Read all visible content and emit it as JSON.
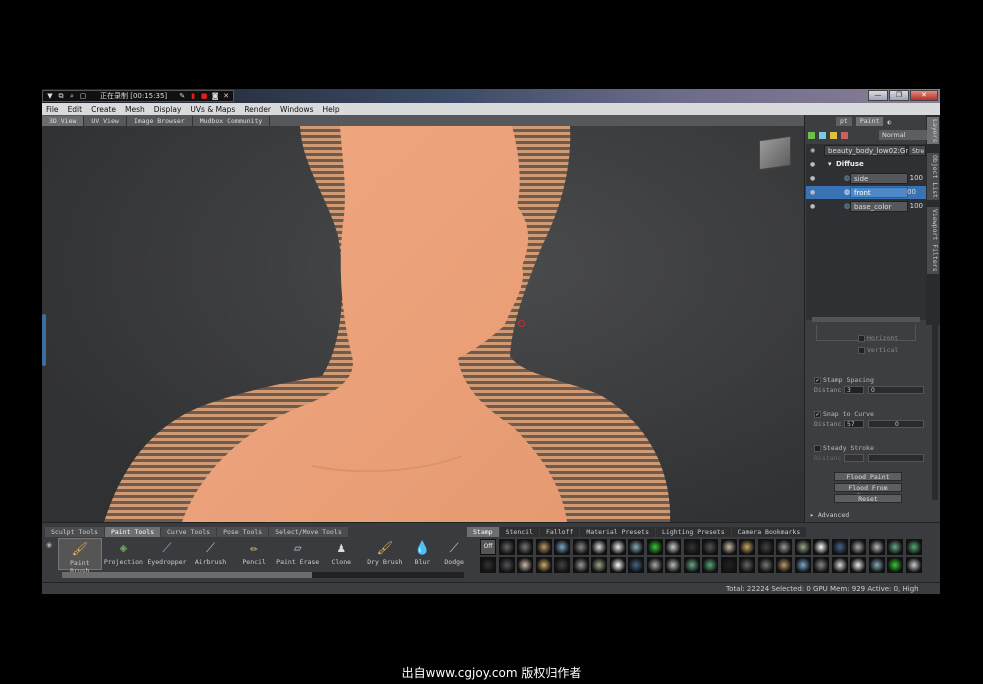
{
  "recorder": {
    "status": "正在录制 [00:15:35]"
  },
  "menu": [
    "File",
    "Edit",
    "Create",
    "Mesh",
    "Display",
    "UVs & Maps",
    "Render",
    "Windows",
    "Help"
  ],
  "view_tabs": [
    "3D View",
    "UV View",
    "Image Browser",
    "Mudbox Community"
  ],
  "right_panel": {
    "header_tabs": [
      "pt",
      "Paint"
    ],
    "blend_mode": "Normal",
    "side_tabs": [
      "Layers",
      "Object List",
      "Viewport Filters"
    ],
    "layers": {
      "object": "beauty_body_low02:Gr",
      "object_suffix": "Stre",
      "group": "Diffuse",
      "items": [
        {
          "name": "side",
          "opacity": "100"
        },
        {
          "name": "front",
          "opacity": "00",
          "selected": true
        },
        {
          "name": "base_color",
          "opacity": "100"
        }
      ]
    },
    "props": {
      "horizontal": "Horizont",
      "vertical": "Vertical",
      "stamp_spacing": "Stamp Spacing",
      "stamp_distance_label": "Distanc",
      "stamp_distance_value": "3",
      "stamp_distance_slider": "0",
      "snap_to_curve": "Snap to Curve",
      "snap_distance_label": "Distanc",
      "snap_distance_value": "57",
      "snap_distance_slider": "0",
      "steady_stroke": "Steady Stroke",
      "steady_distance_label": "Distanc",
      "flood_paint_layer": "Flood Paint Layer",
      "flood_from_camera": "Flood From Camera",
      "reset": "Reset",
      "advanced": "Advanced"
    }
  },
  "tool_tabs": [
    "Sculpt Tools",
    "Paint Tools",
    "Curve Tools",
    "Pose Tools",
    "Select/Move Tools"
  ],
  "tools": [
    {
      "label": "Paint Brush",
      "icon": "paintbrush-icon"
    },
    {
      "label": "Projection",
      "icon": "projection-icon"
    },
    {
      "label": "Eyedropper",
      "icon": "eyedropper-icon"
    },
    {
      "label": "Airbrush",
      "icon": "airbrush-icon"
    },
    {
      "label": "Pencil",
      "icon": "pencil-icon"
    },
    {
      "label": "Paint Erase",
      "icon": "eraser-icon"
    },
    {
      "label": "Clone",
      "icon": "clone-icon"
    },
    {
      "label": "Dry Brush",
      "icon": "drybrush-icon"
    },
    {
      "label": "Blur",
      "icon": "blur-icon"
    },
    {
      "label": "Dodge",
      "icon": "dodge-icon"
    }
  ],
  "stamp_tabs": [
    "Stamp",
    "Stencil",
    "Falloff",
    "Material Presets",
    "Lighting Presets",
    "Camera Bookmarks"
  ],
  "stamp_off_label": "Off",
  "status": "Total: 22224  Selected: 0 GPU Mem: 929  Active: 0, High",
  "credit": "出自www.cgjoy.com 版权归作者"
}
